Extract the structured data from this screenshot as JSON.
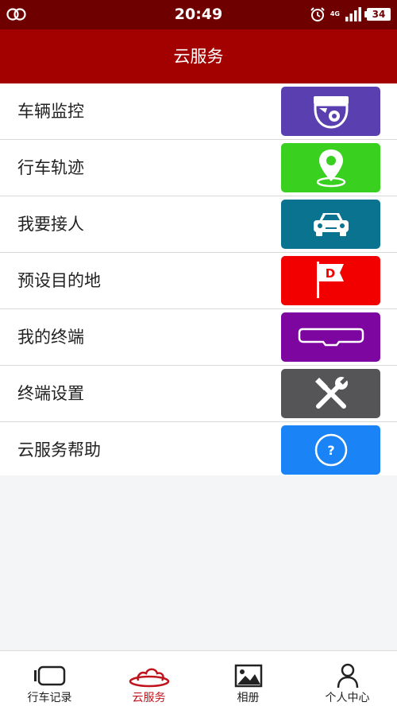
{
  "status_bar": {
    "time": "20:49",
    "network": "4G",
    "battery": "34"
  },
  "header": {
    "title": "云服务"
  },
  "menu": {
    "items": [
      {
        "label": "车辆监控",
        "icon": "camera-icon",
        "color": "#5a3fb0"
      },
      {
        "label": "行车轨迹",
        "icon": "location-pin-icon",
        "color": "#39d020"
      },
      {
        "label": "我要接人",
        "icon": "car-icon",
        "color": "#0a7490"
      },
      {
        "label": "预设目的地",
        "icon": "destination-flag-icon",
        "color": "#f20000"
      },
      {
        "label": "我的终端",
        "icon": "rearview-mirror-icon",
        "color": "#7d06a0"
      },
      {
        "label": "终端设置",
        "icon": "tools-icon",
        "color": "#555557"
      },
      {
        "label": "云服务帮助",
        "icon": "help-icon",
        "color": "#1a84f6"
      }
    ]
  },
  "tabbar": {
    "tabs": [
      {
        "label": "行车记录",
        "icon": "dashcam-icon"
      },
      {
        "label": "云服务",
        "icon": "cloud-icon",
        "active": true
      },
      {
        "label": "相册",
        "icon": "photo-icon"
      },
      {
        "label": "个人中心",
        "icon": "person-icon"
      }
    ]
  },
  "colors": {
    "status_bar": "#6e0000",
    "title_bar": "#a30000",
    "active_tab": "#c0141c"
  }
}
